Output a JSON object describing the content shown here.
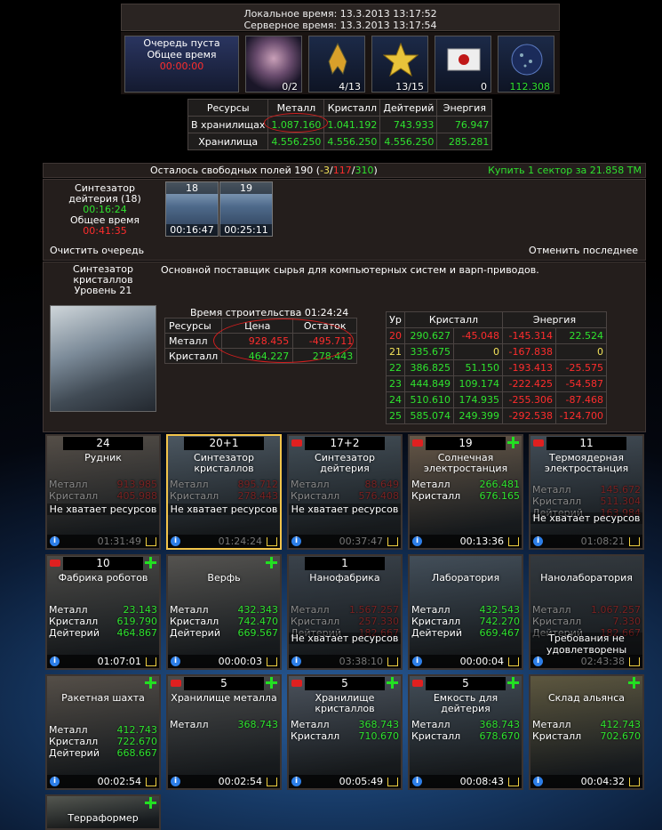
{
  "header": {
    "local_label": "Локальное время:",
    "local_time": "13.3.2013 13:17:52",
    "server_label": "Серверное время:",
    "server_time": "13.3.2013 13:17:54"
  },
  "queue_box": {
    "line1": "Очередь пуста",
    "line2": "Общее время",
    "time": "00:00:00"
  },
  "icons": [
    {
      "name": "nebula-icon",
      "value": "0/2"
    },
    {
      "name": "fleet-ship-icon",
      "value": "4/13"
    },
    {
      "name": "star-icon",
      "value": "13/15"
    },
    {
      "name": "mail-envelope-icon",
      "value": "0"
    },
    {
      "name": "planet-icon",
      "value": "112.308"
    }
  ],
  "resources": {
    "headers": [
      "Ресурсы",
      "Металл",
      "Кристалл",
      "Дейтерий",
      "Энергия"
    ],
    "stored_label": "В хранилищах",
    "stored": [
      "1.087.160",
      "1.041.192",
      "743.933",
      "76.947"
    ],
    "capacity_label": "Хранилища",
    "capacity": [
      "4.556.250",
      "4.556.250",
      "4.556.250",
      "285.281"
    ]
  },
  "fields": {
    "text": "Осталось свободных полей 190 (",
    "a": "-3",
    "sep1": "/",
    "b": "117",
    "sep2": "/",
    "c": "310",
    "close": ")",
    "buy": "Купить 1 сектор за 21.858 ТМ"
  },
  "build_queue": {
    "name": "Синтезатор дейтерия (18)",
    "time": "00:16:24",
    "total_label": "Общее время",
    "total": "00:41:35",
    "items": [
      {
        "level": "18",
        "time": "00:16:47"
      },
      {
        "level": "19",
        "time": "00:25:11"
      }
    ],
    "clear": "Очистить очередь",
    "cancel": "Отменить последнее"
  },
  "building": {
    "name1": "Синтезатор",
    "name2": "кристаллов",
    "level": "Уровень 21",
    "desc": "Основной поставщик сырья для компьютерных систем и варп-приводов.",
    "time_label": "Время строительства 01:24:24",
    "cost_headers": [
      "Ресурсы",
      "Цена",
      "Остаток"
    ],
    "cost_rows": [
      {
        "res": "Металл",
        "price": "928.455",
        "rest": "-495.711"
      },
      {
        "res": "Кристалл",
        "price": "464.227",
        "rest": "278.443"
      }
    ],
    "lv_headers": [
      "Ур",
      "Кристалл",
      "Энергия"
    ],
    "lv_rows": [
      {
        "lv": "20",
        "a": "290.627",
        "b": "-45.048",
        "c": "-145.314",
        "d": "22.524"
      },
      {
        "lv": "21",
        "a": "335.675",
        "b": "0",
        "c": "-167.838",
        "d": "0"
      },
      {
        "lv": "22",
        "a": "386.825",
        "b": "51.150",
        "c": "-193.413",
        "d": "-25.575"
      },
      {
        "lv": "23",
        "a": "444.849",
        "b": "109.174",
        "c": "-222.425",
        "d": "-54.587"
      },
      {
        "lv": "24",
        "a": "510.610",
        "b": "174.935",
        "c": "-255.306",
        "d": "-87.468"
      },
      {
        "lv": "25",
        "a": "585.074",
        "b": "249.399",
        "c": "-292.538",
        "d": "-124.700"
      }
    ]
  },
  "tiles": [
    {
      "level": "24",
      "name": "Рудник",
      "r": [
        [
          "Металл",
          "913.985"
        ],
        [
          "Кристалл",
          "405.988"
        ]
      ],
      "warn": "Не хватает ресурсов",
      "time": "01:31:49"
    },
    {
      "level": "20+1",
      "name": "Синтезатор кристаллов",
      "r": [
        [
          "Металл",
          "895.712"
        ],
        [
          "Кристалл",
          "278.443"
        ]
      ],
      "warn": "Не хватает ресурсов",
      "time": "01:24:24"
    },
    {
      "level": "17+2",
      "name": "Синтезатор дейтерия",
      "r": [
        [
          "Металл",
          "88.649"
        ],
        [
          "Кристалл",
          "576.408"
        ]
      ],
      "warn": "Не хватает ресурсов",
      "time": "00:37:47"
    },
    {
      "level": "19",
      "name": "Солнечная электростанция",
      "r": [
        [
          "Металл",
          "266.481"
        ],
        [
          "Кристалл",
          "676.165"
        ]
      ],
      "warn": "",
      "time": "00:13:36"
    },
    {
      "level": "11",
      "name": "Термоядерная электростанция",
      "r": [
        [
          "Металл",
          "145.672"
        ],
        [
          "Кристалл",
          "511.304"
        ],
        [
          "Дейтерий",
          "163.984"
        ]
      ],
      "warn": "Не хватает ресурсов",
      "time": "01:08:21"
    },
    {
      "level": "10",
      "name": "Фабрика роботов",
      "r": [
        [
          "Металл",
          "23.143"
        ],
        [
          "Кристалл",
          "619.790"
        ],
        [
          "Дейтерий",
          "464.867"
        ]
      ],
      "warn": "",
      "time": "01:07:01"
    },
    {
      "level": "",
      "name": "Верфь",
      "r": [
        [
          "Металл",
          "432.343"
        ],
        [
          "Кристалл",
          "742.470"
        ],
        [
          "Дейтерий",
          "669.567"
        ]
      ],
      "warn": "",
      "time": "00:00:03"
    },
    {
      "level": "1",
      "name": "Нанофабрика",
      "r": [
        [
          "Металл",
          "1.567.257"
        ],
        [
          "Кристалл",
          "257.330"
        ],
        [
          "Дейтерий",
          "182.667"
        ]
      ],
      "warn": "Не хватает ресурсов",
      "time": "03:38:10"
    },
    {
      "level": "",
      "name": "Лаборатория",
      "r": [
        [
          "Металл",
          "432.543"
        ],
        [
          "Кристалл",
          "742.270"
        ],
        [
          "Дейтерий",
          "669.467"
        ]
      ],
      "warn": "",
      "time": "00:00:04"
    },
    {
      "level": "",
      "name": "Нанолаборатория",
      "r": [
        [
          "Металл",
          "1.067.257"
        ],
        [
          "Кристалл",
          "7.330"
        ],
        [
          "Дейтерий",
          "182.667"
        ]
      ],
      "warn": "Требования не удовлетворены",
      "time": "02:43:38"
    },
    {
      "level": "",
      "name": "Ракетная шахта",
      "r": [
        [
          "Металл",
          "412.743"
        ],
        [
          "Кристалл",
          "722.670"
        ],
        [
          "Дейтерий",
          "668.667"
        ]
      ],
      "warn": "",
      "time": "00:02:54"
    },
    {
      "level": "5",
      "name": "Хранилище металла",
      "r": [
        [
          "Металл",
          "368.743"
        ]
      ],
      "warn": "",
      "time": "00:02:54"
    },
    {
      "level": "5",
      "name": "Хранилище кристаллов",
      "r": [
        [
          "Металл",
          "368.743"
        ],
        [
          "Кристалл",
          "710.670"
        ]
      ],
      "warn": "",
      "time": "00:05:49"
    },
    {
      "level": "5",
      "name": "Емкость для дейтерия",
      "r": [
        [
          "Металл",
          "368.743"
        ],
        [
          "Кристалл",
          "678.670"
        ]
      ],
      "warn": "",
      "time": "00:08:43"
    },
    {
      "level": "",
      "name": "Склад альянса",
      "r": [
        [
          "Металл",
          "412.743"
        ],
        [
          "Кристалл",
          "702.670"
        ]
      ],
      "warn": "",
      "time": "00:04:32"
    },
    {
      "level": "",
      "name": "Терраформер",
      "r": [],
      "warn": "",
      "time": ""
    }
  ]
}
